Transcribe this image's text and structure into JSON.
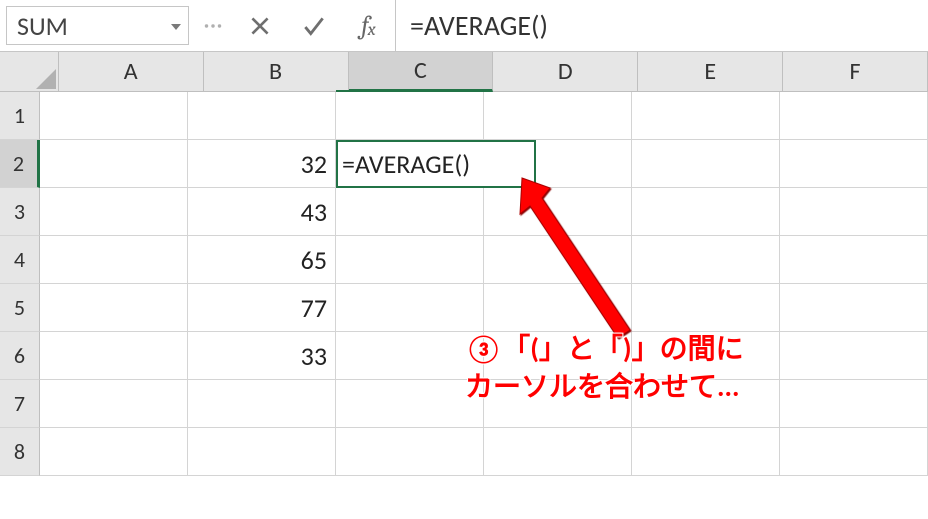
{
  "formula_bar": {
    "name_box": "SUM",
    "formula": "=AVERAGE()"
  },
  "columns": [
    "A",
    "B",
    "C",
    "D",
    "E",
    "F"
  ],
  "active_column_index": 2,
  "rows": [
    "1",
    "2",
    "3",
    "4",
    "5",
    "6",
    "7",
    "8"
  ],
  "active_row_index": 1,
  "active_cell_display": "=AVERAGE()",
  "cells": {
    "B2": "32",
    "B3": "43",
    "B4": "65",
    "B5": "77",
    "B6": "33"
  },
  "annotation": {
    "line1": "③「(」と「)」の間に",
    "line2": "カーソルを合わせて..."
  }
}
